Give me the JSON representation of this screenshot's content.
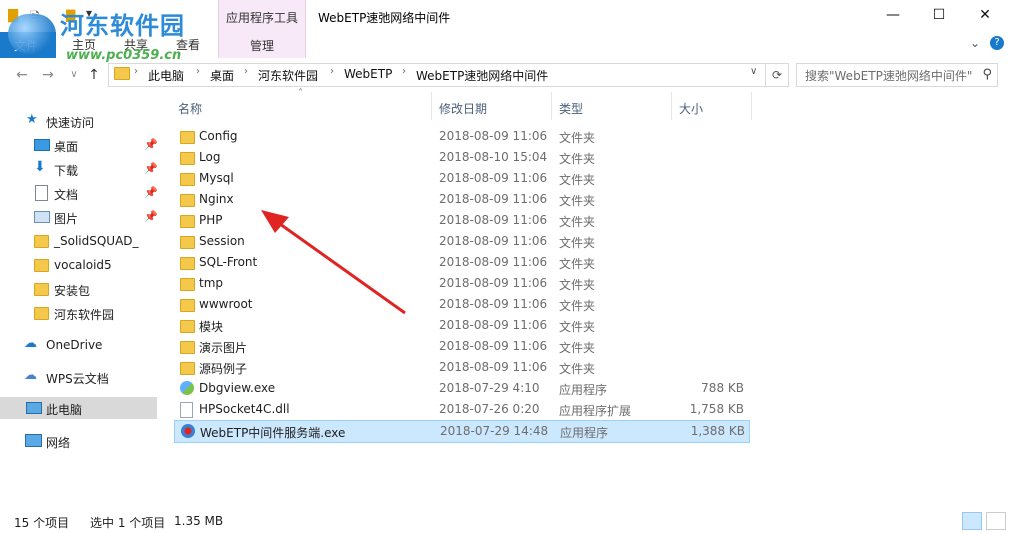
{
  "window": {
    "title": "WebETP速弛网络中间件",
    "controls": {
      "minimize": "—",
      "maximize": "☐",
      "close": "✕"
    }
  },
  "watermark": {
    "logo": "河东软件园",
    "url": "www.pc0359.cn"
  },
  "ribbon": {
    "context_group": "应用程序工具",
    "context_tab": "管理",
    "tabs": [
      "文件",
      "主页",
      "共享",
      "查看"
    ]
  },
  "address": {
    "crumbs": [
      "此电脑",
      "桌面",
      "河东软件园",
      "WebETP",
      "WebETP速弛网络中间件"
    ],
    "search_placeholder": "搜索\"WebETP速弛网络中间件\""
  },
  "sidebar": {
    "items": [
      {
        "label": "快速访问",
        "icon": "star-icon"
      },
      {
        "label": "桌面",
        "icon": "desktop-icon",
        "pinned": true
      },
      {
        "label": "下载",
        "icon": "download-icon",
        "pinned": true
      },
      {
        "label": "文档",
        "icon": "document-icon",
        "pinned": true
      },
      {
        "label": "图片",
        "icon": "picture-icon",
        "pinned": true
      },
      {
        "label": "_SolidSQUAD_",
        "icon": "folder-icon"
      },
      {
        "label": "vocaloid5",
        "icon": "folder-icon"
      },
      {
        "label": "安装包",
        "icon": "folder-icon"
      },
      {
        "label": "河东软件园",
        "icon": "folder-icon"
      },
      {
        "label": "OneDrive",
        "icon": "cloud-icon"
      },
      {
        "label": "WPS云文档",
        "icon": "cloud-icon"
      },
      {
        "label": "此电脑",
        "icon": "computer-icon"
      },
      {
        "label": "网络",
        "icon": "network-icon"
      }
    ]
  },
  "columns": {
    "name": "名称",
    "date": "修改日期",
    "type": "类型",
    "size": "大小"
  },
  "files": [
    {
      "name": "Config",
      "date": "2018-08-09 11:06",
      "type": "文件夹",
      "size": "",
      "kind": "folder"
    },
    {
      "name": "Log",
      "date": "2018-08-10 15:04",
      "type": "文件夹",
      "size": "",
      "kind": "folder"
    },
    {
      "name": "Mysql",
      "date": "2018-08-09 11:06",
      "type": "文件夹",
      "size": "",
      "kind": "folder"
    },
    {
      "name": "Nginx",
      "date": "2018-08-09 11:06",
      "type": "文件夹",
      "size": "",
      "kind": "folder"
    },
    {
      "name": "PHP",
      "date": "2018-08-09 11:06",
      "type": "文件夹",
      "size": "",
      "kind": "folder"
    },
    {
      "name": "Session",
      "date": "2018-08-09 11:06",
      "type": "文件夹",
      "size": "",
      "kind": "folder"
    },
    {
      "name": "SQL-Front",
      "date": "2018-08-09 11:06",
      "type": "文件夹",
      "size": "",
      "kind": "folder"
    },
    {
      "name": "tmp",
      "date": "2018-08-09 11:06",
      "type": "文件夹",
      "size": "",
      "kind": "folder"
    },
    {
      "name": "wwwroot",
      "date": "2018-08-09 11:06",
      "type": "文件夹",
      "size": "",
      "kind": "folder"
    },
    {
      "name": "模块",
      "date": "2018-08-09 11:06",
      "type": "文件夹",
      "size": "",
      "kind": "folder"
    },
    {
      "name": "演示图片",
      "date": "2018-08-09 11:06",
      "type": "文件夹",
      "size": "",
      "kind": "folder"
    },
    {
      "name": "源码例子",
      "date": "2018-08-09 11:06",
      "type": "文件夹",
      "size": "",
      "kind": "folder"
    },
    {
      "name": "Dbgview.exe",
      "date": "2018-07-29 4:10",
      "type": "应用程序",
      "size": "788 KB",
      "kind": "exe"
    },
    {
      "name": "HPSocket4C.dll",
      "date": "2018-07-26 0:20",
      "type": "应用程序扩展",
      "size": "1,758 KB",
      "kind": "dll"
    },
    {
      "name": "WebETP中间件服务端.exe",
      "date": "2018-07-29 14:48",
      "type": "应用程序",
      "size": "1,388 KB",
      "kind": "exe2"
    }
  ],
  "status": {
    "count": "15 个项目",
    "selected": "选中 1 个项目",
    "size": "1.35 MB"
  },
  "colors": {
    "accent": "#1979ca",
    "selection": "#cce8ff",
    "arrow": "#e02424"
  }
}
